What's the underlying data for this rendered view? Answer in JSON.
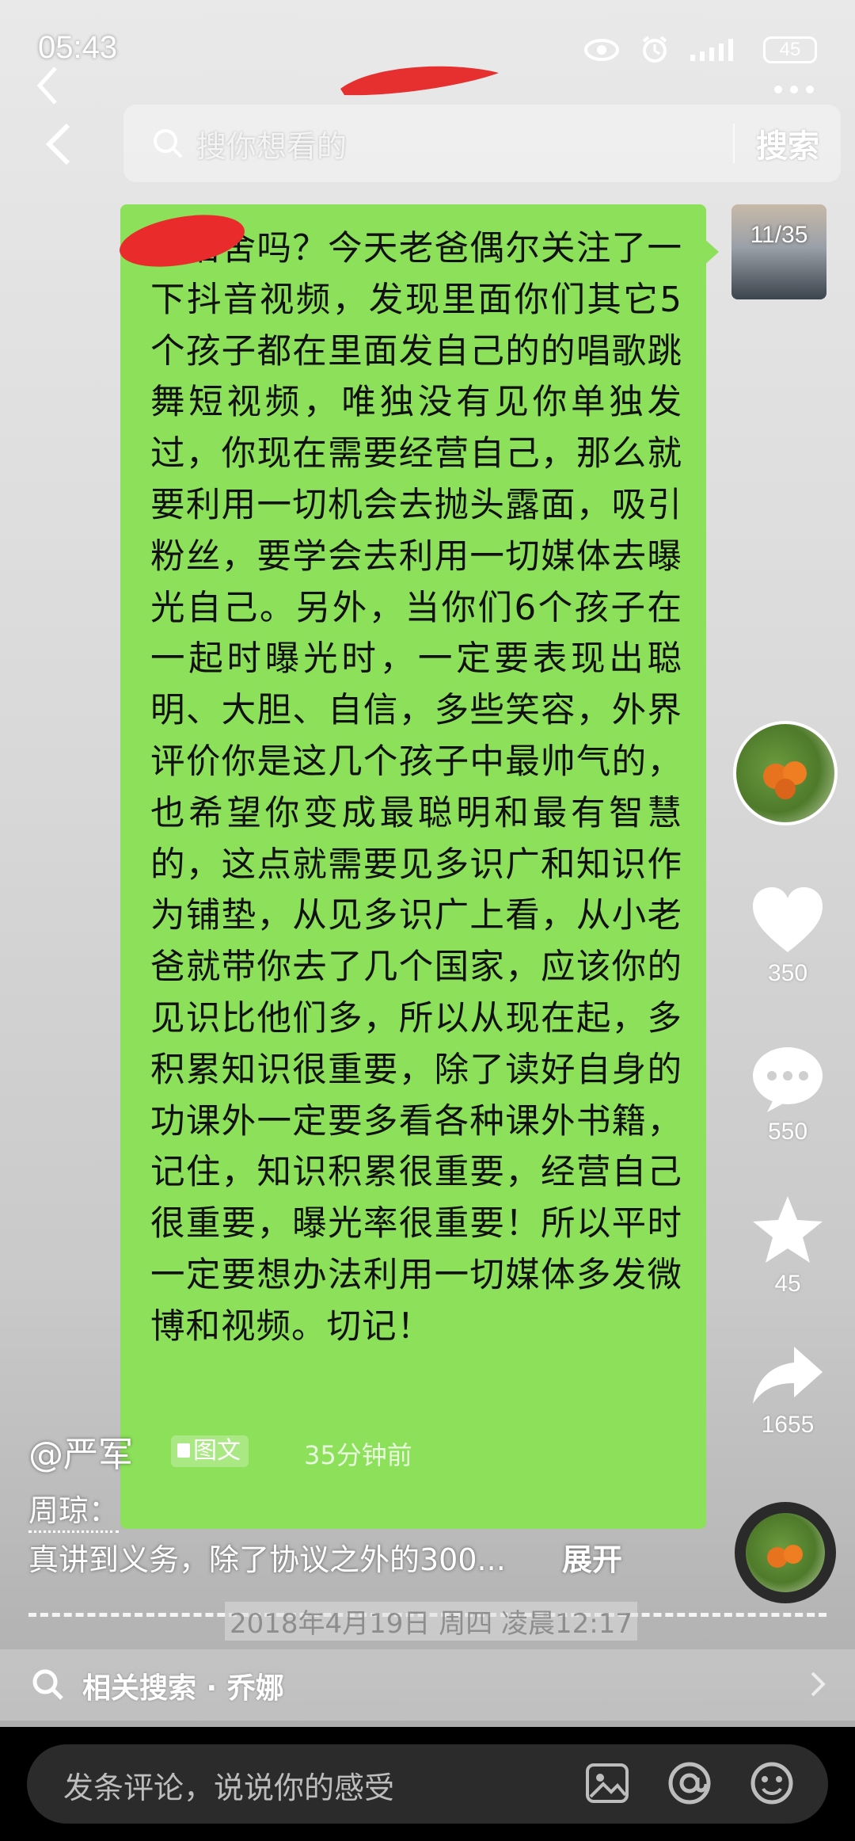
{
  "status_bar": {
    "time": "05:43",
    "battery": "45"
  },
  "search": {
    "placeholder": "搜你想看的",
    "button": "搜索"
  },
  "message": {
    "counter": "11/35",
    "text": "在宿舍吗？今天老爸偶尔关注了一下抖音视频，发现里面你们其它5个孩子都在里面发自己的的唱歌跳舞短视频，唯独没有见你单独发过，你现在需要经营自己，那么就要利用一切机会去抛头露面，吸引粉丝，要学会去利用一切媒体去曝光自己。另外，当你们6个孩子在一起时曝光时，一定要表现出聪明、大胆、自信，多些笑容，外界评价你是这几个孩子中最帅气的，也希望你变成最聪明和最有智慧的，这点就需要见多识广和知识作为铺垫，从见多识广上看，从小老爸就带你去了几个国家，应该你的见识比他们多，所以从现在起，多积累知识很重要，除了读好自身的功课外一定要多看各种课外书籍，记住，知识积累很重要，经营自己很重要，曝光率很重要！所以平时一定要想办法利用一切媒体多发微博和视频。切记！"
  },
  "actions": {
    "like_count": "350",
    "comment_count": "550",
    "favorite_count": "45",
    "share_count": "1655"
  },
  "post": {
    "author": "@严军",
    "type_badge": "图文",
    "time_ago": "35分钟前",
    "tagged_user": "周琼：",
    "caption": "真讲到义务，除了协议之外的300...",
    "expand": "展开",
    "timestamp": "2018年4月19日 周四 凌晨12:17"
  },
  "related": {
    "label": "相关搜索 · 乔娜"
  },
  "comment_bar": {
    "placeholder": "发条评论，说说你的感受"
  },
  "colors": {
    "bubble": "#8ce05a",
    "bottom_bar": "#000000"
  }
}
